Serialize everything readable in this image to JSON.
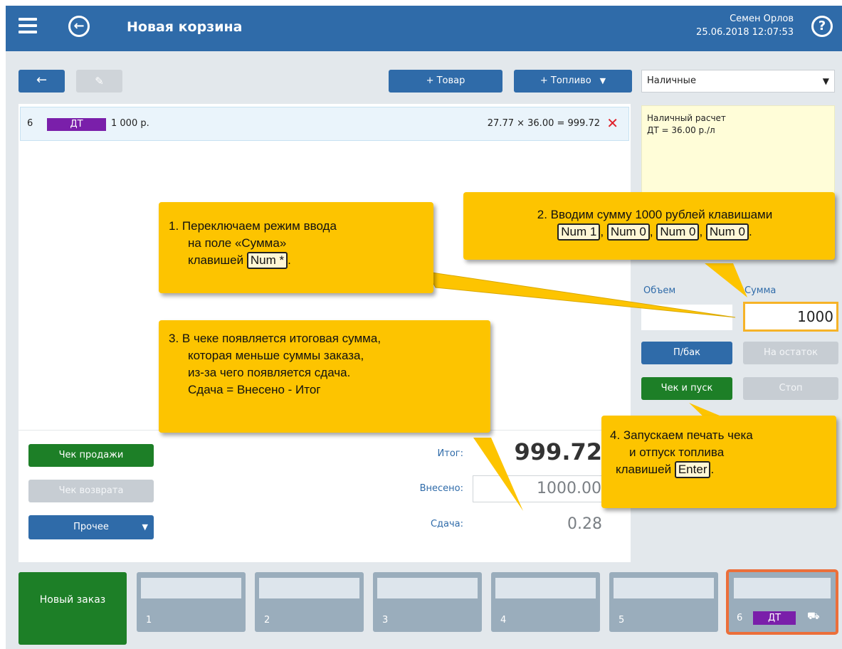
{
  "header": {
    "title": "Новая корзина",
    "user_name": "Семен Орлов",
    "datetime": "25.06.2018 12:07:53",
    "help_glyph": "?",
    "back_glyph": "←",
    "accent_color": "#2f6ba9"
  },
  "toolbar": {
    "back_glyph": "←",
    "edit_glyph": "✎",
    "add_product_label": "+ Товар",
    "add_fuel_label": "+ Топливо",
    "caret": "▼",
    "payment_method": "Наличные"
  },
  "order": {
    "row_number": "6",
    "fuel_type": "ДТ",
    "amount": "1 000 р.",
    "calculation": "27.77 × 36.00 = 999.72",
    "remove_glyph": "✕"
  },
  "totals": {
    "total_label": "Итог:",
    "total_value": "999.72",
    "paid_label": "Внесено:",
    "paid_value": "1000.00",
    "change_label": "Сдача:",
    "change_value": "0.28"
  },
  "actions": {
    "sale_receipt": "Чек продажи",
    "return_receipt": "Чек возврата",
    "other": "Прочее"
  },
  "info": {
    "line1": "Наличный расчет",
    "line2": "ДТ = 36.00 р./л"
  },
  "fuel_controls": {
    "volume_label": "Объем",
    "sum_label": "Сумма",
    "sum_value": "1000",
    "full_tank": "П/бак",
    "to_remainder": "На остаток",
    "receipt_and_start": "Чек и пуск",
    "stop": "Стоп"
  },
  "bottom_tabs": {
    "new_order": "Новый заказ",
    "slots": [
      "1",
      "2",
      "3",
      "4",
      "5",
      "6"
    ],
    "slot6_fuel": "ДТ",
    "cart_glyph": "⛟"
  },
  "callouts": {
    "c1": {
      "line1": "1. Переключаем режим ввода",
      "line2": "на поле «Сумма»",
      "line3_text": "клавишей ",
      "key": "Num *",
      "line3_end": "."
    },
    "c2": {
      "line1": "2. Вводим сумму 1000 рублей клавишами",
      "keys": [
        "Num 1",
        "Num 0",
        "Num 0",
        "Num 0"
      ],
      "sep": ",",
      "end": "."
    },
    "c3": {
      "line1": "3. В чеке появляется итоговая сумма,",
      "line2": "которая меньше суммы заказа,",
      "line3": "из-за чего появляется сдача.",
      "line4": "Сдача = Внесено - Итог"
    },
    "c4": {
      "line1": "4. Запускаем печать чека",
      "line2": "и отпуск топлива",
      "line3_text": "клавишей ",
      "key": "Enter",
      "line3_end": "."
    }
  }
}
